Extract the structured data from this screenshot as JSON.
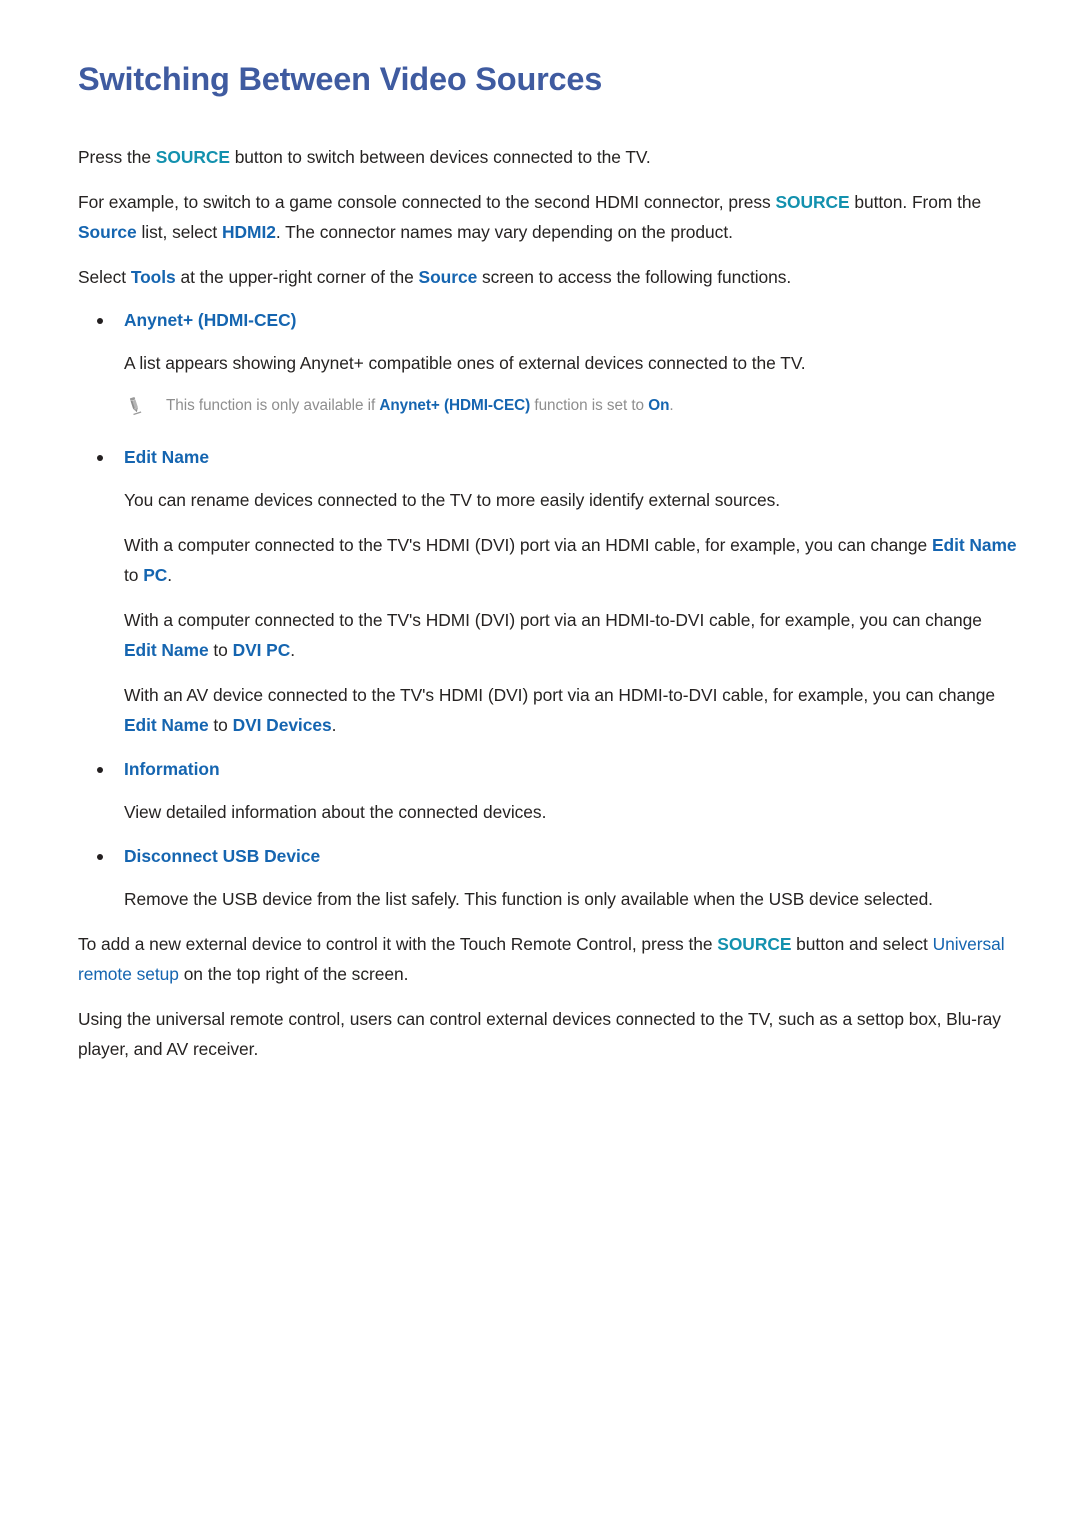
{
  "document": {
    "title": "Switching Between Video Sources",
    "colors": {
      "title_blue": "#3f5ba0",
      "term_blue": "#1565b0",
      "term_teal": "#1391ae",
      "note_gray": "#8e8e8e",
      "body_black": "#262322"
    }
  },
  "intro": {
    "p1": {
      "a": "Press the ",
      "term1": "SOURCE",
      "b": " button to switch between devices connected to the TV."
    },
    "p2": {
      "a": "For example, to switch to a game console connected to the second HDMI connector, press ",
      "term1": "SOURCE",
      "b": " button. From the ",
      "term2": "Source",
      "c": " list, select ",
      "term3": "HDMI2",
      "d": ". The connector names may vary depending on the product."
    },
    "p3": {
      "a": "Select ",
      "term1": "Tools",
      "b": " at the upper-right corner of the ",
      "term2": "Source",
      "c": " screen to access the following functions."
    }
  },
  "bullets": [
    {
      "heading": "Anynet+ (HDMI-CEC)",
      "paragraphs": [
        "A list appears showing Anynet+ compatible ones of external devices connected to the TV."
      ],
      "note": {
        "icon": "pencil-icon",
        "a": "This function is only available if ",
        "term1": "Anynet+ (HDMI-CEC)",
        "b": " function is set to ",
        "term2": "On",
        "c": "."
      }
    },
    {
      "heading": "Edit Name",
      "paragraphs": [
        "You can rename devices connected to the TV to more easily identify external sources."
      ],
      "rich_paragraphs": [
        {
          "a": "With a computer connected to the TV's HDMI (DVI) port via an HDMI cable, for example, you can change ",
          "term1": "Edit Name",
          "b": " to ",
          "term2": "PC",
          "c": "."
        },
        {
          "a": "With a computer connected to the TV's HDMI (DVI) port via an HDMI-to-DVI cable, for example, you can change ",
          "term1": "Edit Name",
          "b": " to ",
          "term2": "DVI PC",
          "c": "."
        },
        {
          "a": "With an AV device connected to the TV's HDMI (DVI) port via an HDMI-to-DVI cable, for example, you can change ",
          "term1": "Edit Name",
          "b": " to ",
          "term2": "DVI Devices",
          "c": "."
        }
      ]
    },
    {
      "heading": "Information",
      "paragraphs": [
        "View detailed information about the connected devices."
      ]
    },
    {
      "heading": "Disconnect USB Device",
      "paragraphs": [
        "Remove the USB device from the list safely. This function is only available when the USB device selected."
      ]
    }
  ],
  "outro": {
    "p1": {
      "a": "To add a new external device to control it with the Touch Remote Control, press the ",
      "term1": "SOURCE",
      "b": " button and select ",
      "term2": "Universal remote setup",
      "c": " on the top right of the screen."
    },
    "p2": "Using the universal remote control, users can control external devices connected to the TV, such as a settop box, Blu-ray player, and AV receiver."
  }
}
